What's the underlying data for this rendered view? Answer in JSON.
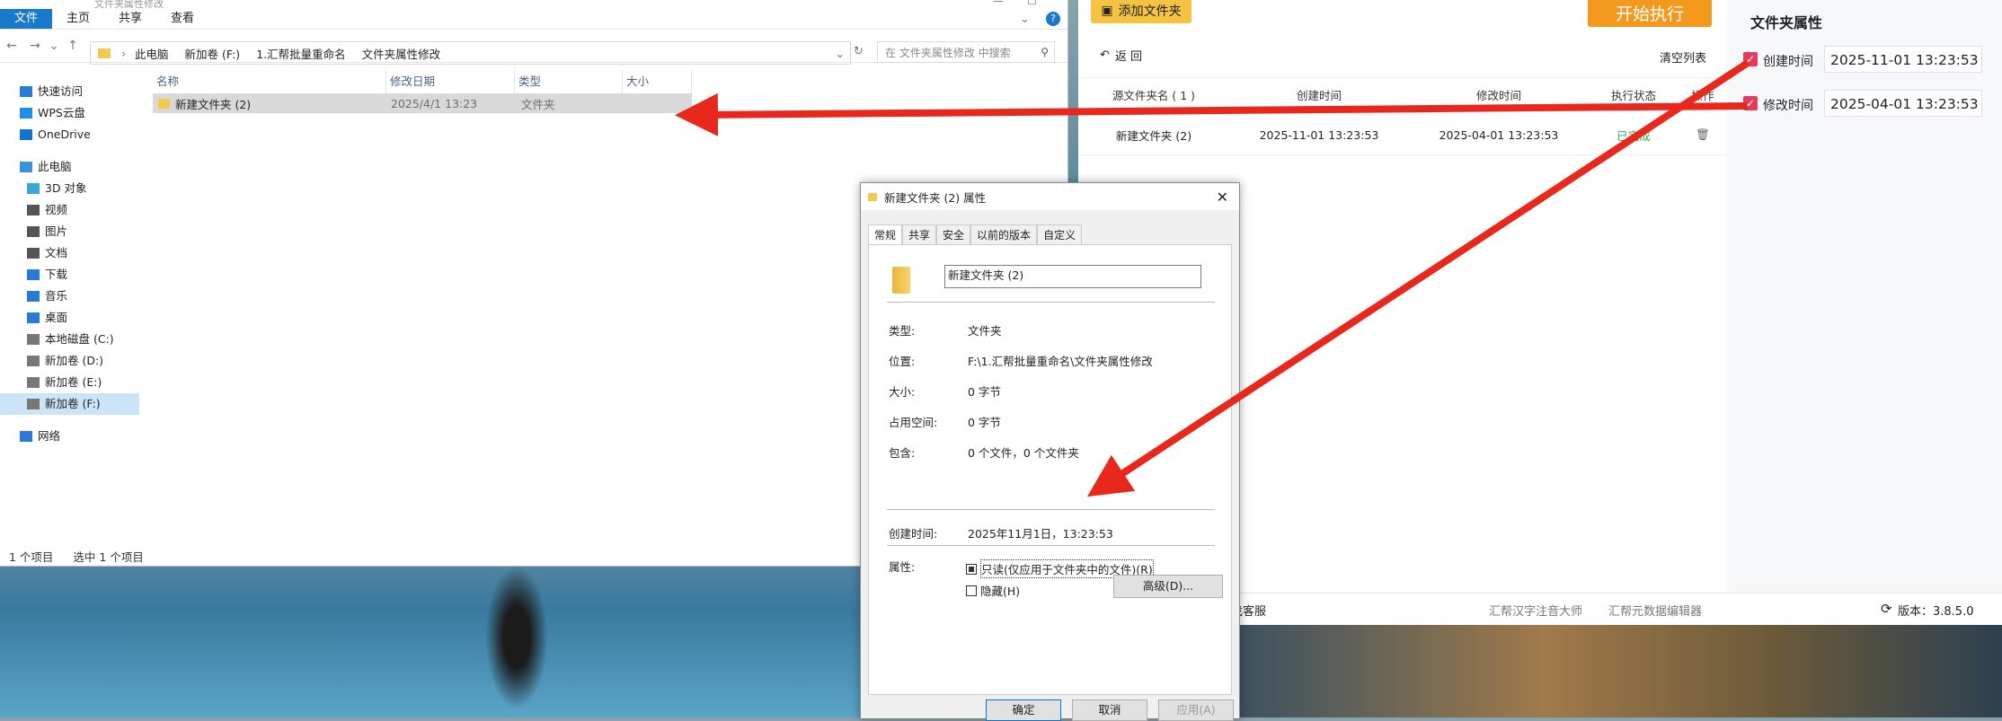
{
  "explorer": {
    "title": "文件夹属性修改",
    "menu": [
      "文件",
      "主页",
      "共享",
      "查看"
    ],
    "breadcrumb": [
      "此电脑",
      "新加卷 (F:)",
      "1.汇帮批量重命名",
      "文件夹属性修改"
    ],
    "search_placeholder": "在 文件夹属性修改 中搜索",
    "sidebar": [
      {
        "label": "快速访问",
        "icon": "star-icon",
        "indent": 0
      },
      {
        "label": "WPS云盘",
        "icon": "cloud-icon",
        "indent": 0
      },
      {
        "label": "OneDrive",
        "icon": "onedrive-icon",
        "indent": 0
      },
      {
        "label": "此电脑",
        "icon": "computer-icon",
        "indent": 0
      },
      {
        "label": "3D 对象",
        "icon": "cube-icon",
        "indent": 1
      },
      {
        "label": "视频",
        "icon": "video-icon",
        "indent": 1
      },
      {
        "label": "图片",
        "icon": "picture-icon",
        "indent": 1
      },
      {
        "label": "文档",
        "icon": "document-icon",
        "indent": 1
      },
      {
        "label": "下载",
        "icon": "download-icon",
        "indent": 1
      },
      {
        "label": "音乐",
        "icon": "music-icon",
        "indent": 1
      },
      {
        "label": "桌面",
        "icon": "desktop-icon",
        "indent": 1
      },
      {
        "label": "本地磁盘 (C:)",
        "icon": "drive-icon",
        "indent": 1
      },
      {
        "label": "新加卷 (D:)",
        "icon": "drive-icon",
        "indent": 1
      },
      {
        "label": "新加卷 (E:)",
        "icon": "drive-icon",
        "indent": 1
      },
      {
        "label": "新加卷 (F:)",
        "icon": "drive-icon",
        "indent": 1,
        "selected": true
      },
      {
        "label": "网络",
        "icon": "network-icon",
        "indent": 0
      }
    ],
    "columns": [
      "名称",
      "修改日期",
      "类型",
      "大小"
    ],
    "file": {
      "name": "新建文件夹 (2)",
      "modified": "2025/4/1 13:23",
      "type": "文件夹"
    },
    "status_count": "1 个项目",
    "status_selected": "选中 1 个项目"
  },
  "dialog": {
    "title": "新建文件夹 (2) 属性",
    "tabs": [
      "常规",
      "共享",
      "安全",
      "以前的版本",
      "自定义"
    ],
    "name_value": "新建文件夹 (2)",
    "props": [
      {
        "k": "类型:",
        "v": "文件夹"
      },
      {
        "k": "位置:",
        "v": "F:\\1.汇帮批量重命名\\文件夹属性修改"
      },
      {
        "k": "大小:",
        "v": "0 字节"
      },
      {
        "k": "占用空间:",
        "v": "0 字节"
      },
      {
        "k": "包含:",
        "v": "0 个文件，0 个文件夹"
      }
    ],
    "created_label": "创建时间:",
    "created_value": "2025年11月1日，13:23:53",
    "attr_label": "属性:",
    "readonly_label": "只读(仅应用于文件夹中的文件)(R)",
    "hidden_label": "隐藏(H)",
    "advanced_label": "高级(D)...",
    "ok_label": "确定",
    "cancel_label": "取消",
    "apply_label": "应用(A)"
  },
  "app": {
    "add_folder_label": "添加文件夹",
    "start_label": "开始执行",
    "back_label": "返 回",
    "clear_label": "清空列表",
    "table_headers": [
      "源文件夹名 ( 1 )",
      "创建时间",
      "修改时间",
      "执行状态",
      "操作"
    ],
    "row": {
      "name": "新建文件夹 (2)",
      "created": "2025-11-01 13:23:53",
      "modified": "2025-04-01 13:23:53",
      "status": "已完成"
    },
    "panel_title": "文件夹属性",
    "created_label": "创建时间",
    "created_value": "2025-11-01 13:23:53",
    "modified_label": "修改时间",
    "modified_value": "2025-04-01 13:23:53",
    "footer_service": "找客服",
    "footer_link1": "汇帮汉字注音大师",
    "footer_link2": "汇帮元数据编辑器",
    "version": "版本：3.8.5.0",
    "status_color": "#2fa84f",
    "accent_color": "#f39a1e"
  }
}
